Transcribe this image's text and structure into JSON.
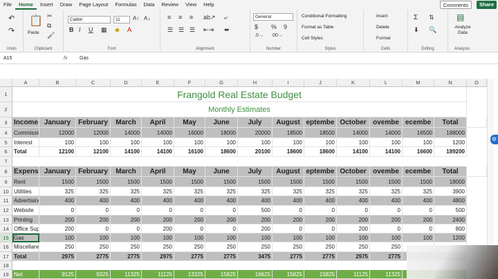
{
  "menu": {
    "tabs": [
      "File",
      "Home",
      "Insert",
      "Draw",
      "Page Layout",
      "Formulas",
      "Data",
      "Review",
      "View",
      "Help"
    ],
    "active": "Home",
    "comments": "Comments",
    "share": "Share"
  },
  "ribbon": {
    "undo_label": "Undo",
    "clipboard_label": "Clipboard",
    "paste_label": "Paste",
    "font_label": "Font",
    "font_name": "Calibri",
    "font_size": "11",
    "alignment_label": "Alignment",
    "number_label": "Number",
    "number_format": "General",
    "styles_label": "Styles",
    "conditional_formatting": "Conditional Formatting",
    "format_as_table": "Format as Table",
    "cell_styles": "Cell Styles",
    "cells_label": "Cells",
    "insert": "Insert",
    "delete": "Delete",
    "format": "Format",
    "editing_label": "Editing",
    "analyze_data": "Analyze Data",
    "analysis_label": "Analysis"
  },
  "formula_bar": {
    "name_box": "A15",
    "fx": "fx",
    "value": "Gas"
  },
  "columns": [
    "A",
    "B",
    "C",
    "D",
    "E",
    "F",
    "G",
    "H",
    "I",
    "J",
    "K",
    "L",
    "M",
    "N",
    "O"
  ],
  "rows": [
    "1",
    "2",
    "3",
    "4",
    "5",
    "6",
    "7",
    "8",
    "9",
    "10",
    "11",
    "12",
    "13",
    "14",
    "15",
    "16",
    "17",
    "18",
    "19"
  ],
  "sheet": {
    "title": "Frangold Real Estate Budget",
    "subtitle": "Monthly Estimates",
    "income_header": [
      "Income",
      "January",
      "February",
      "March",
      "April",
      "May",
      "June",
      "July",
      "August",
      "eptembe",
      "October",
      "ovembe",
      "ecembe",
      "Total"
    ],
    "income_rows": [
      [
        "Commissio",
        "12000",
        "12000",
        "14000",
        "14000",
        "16000",
        "18000",
        "20000",
        "18500",
        "18500",
        "14000",
        "14000",
        "16500",
        "188000"
      ],
      [
        "Interest",
        "100",
        "100",
        "100",
        "100",
        "100",
        "100",
        "100",
        "100",
        "100",
        "100",
        "100",
        "100",
        "1200"
      ],
      [
        "Total",
        "12100",
        "12100",
        "14100",
        "14100",
        "16100",
        "18600",
        "20100",
        "18600",
        "18600",
        "14100",
        "14100",
        "16600",
        "189200"
      ]
    ],
    "expense_header": [
      "Expenses",
      "January",
      "February",
      "March",
      "April",
      "May",
      "June",
      "July",
      "August",
      "eptembe",
      "October",
      "ovembe",
      "ecembe",
      "Total"
    ],
    "expense_rows": [
      [
        "Rent",
        "1500",
        "1500",
        "1500",
        "1500",
        "1500",
        "1500",
        "1500",
        "1500",
        "1500",
        "1500",
        "1500",
        "1500",
        "18000"
      ],
      [
        "Utilities",
        "325",
        "325",
        "325",
        "325",
        "325",
        "325",
        "325",
        "325",
        "325",
        "325",
        "325",
        "325",
        "3900"
      ],
      [
        "Advertising",
        "400",
        "400",
        "400",
        "400",
        "400",
        "400",
        "400",
        "400",
        "400",
        "400",
        "400",
        "400",
        "4800"
      ],
      [
        "Website",
        "0",
        "0",
        "0",
        "0",
        "0",
        "0",
        "500",
        "0",
        "0",
        "0",
        "0",
        "0",
        "500"
      ],
      [
        "Printing",
        "200",
        "200",
        "200",
        "200",
        "200",
        "200",
        "200",
        "200",
        "200",
        "200",
        "200",
        "200",
        "2400"
      ],
      [
        "Office Supp",
        "200",
        "0",
        "0",
        "200",
        "0",
        "0",
        "200",
        "0",
        "0",
        "200",
        "0",
        "0",
        "800"
      ],
      [
        "Gas",
        "100",
        "100",
        "100",
        "100",
        "100",
        "100",
        "100",
        "100",
        "100",
        "100",
        "100",
        "100",
        "1200"
      ],
      [
        "Miscellane",
        "250",
        "250",
        "250",
        "250",
        "250",
        "250",
        "250",
        "250",
        "250",
        "250",
        "250",
        "",
        ""
      ],
      [
        "Total",
        "2975",
        "2775",
        "2775",
        "2975",
        "2775",
        "2775",
        "3475",
        "2775",
        "2775",
        "2975",
        "2775",
        "",
        ""
      ]
    ],
    "net_row": [
      "Net",
      "9125",
      "9325",
      "11325",
      "11125",
      "13325",
      "15825",
      "16625",
      "15825",
      "15825",
      "11125",
      "11325",
      "",
      ""
    ]
  },
  "colors": {
    "accent": "#1e6b3a",
    "title_green": "#3f8f3f",
    "band_gray": "#bfbfbf",
    "net_green": "#70ad47"
  }
}
